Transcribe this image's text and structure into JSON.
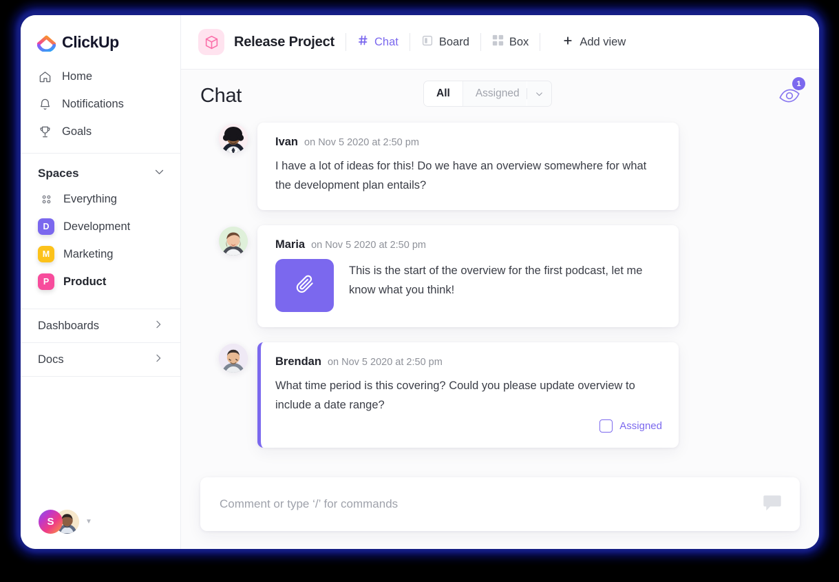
{
  "brand": {
    "name": "ClickUp",
    "accent": "#7b68ee",
    "frame_color": "#111a7e"
  },
  "sidebar": {
    "nav": [
      {
        "label": "Home",
        "icon": "home-icon"
      },
      {
        "label": "Notifications",
        "icon": "bell-icon"
      },
      {
        "label": "Goals",
        "icon": "trophy-icon"
      }
    ],
    "spaces_header": "Spaces",
    "spaces": [
      {
        "label": "Everything",
        "badge": "",
        "color": "",
        "icon": "grid-dots-icon",
        "active": false
      },
      {
        "label": "Development",
        "badge": "D",
        "color": "#7b68ee",
        "active": false
      },
      {
        "label": "Marketing",
        "badge": "M",
        "color": "#fcc21b",
        "active": false
      },
      {
        "label": "Product",
        "badge": "P",
        "color": "#f74c9c",
        "active": true
      }
    ],
    "sections": [
      {
        "label": "Dashboards",
        "icon": "chevron-right-icon"
      },
      {
        "label": "Docs",
        "icon": "chevron-right-icon"
      }
    ],
    "footer": {
      "user_initial": "S",
      "avatar_count": 2
    }
  },
  "topbar": {
    "project_title": "Release Project",
    "project_icon": "box-3d-icon",
    "views": [
      {
        "label": "Chat",
        "icon": "hash-icon",
        "active": true
      },
      {
        "label": "Board",
        "icon": "board-icon",
        "active": false
      },
      {
        "label": "Box",
        "icon": "box-grid-icon",
        "active": false
      }
    ],
    "add_view": {
      "label": "Add view",
      "icon": "plus-icon"
    }
  },
  "page": {
    "title": "Chat",
    "filter": {
      "selected": "All",
      "other": "Assigned",
      "caret_icon": "chevron-down-icon"
    },
    "watchers": {
      "icon": "eye-icon",
      "count": "1"
    }
  },
  "messages": [
    {
      "author": "Ivan",
      "time": "on Nov 5 2020 at 2:50 pm",
      "text": "I have a lot of ideas for this! Do we have an overview somewhere for what the development plan entails?",
      "flagged": false,
      "attachment": false,
      "assigned_label": null,
      "avatar_bg": "#fbeef2"
    },
    {
      "author": "Maria",
      "time": "on Nov 5 2020 at 2:50 pm",
      "text": "This is the start of the overview for the first podcast, let me know what you think!",
      "flagged": false,
      "attachment": true,
      "attachment_icon": "paperclip-icon",
      "assigned_label": null,
      "avatar_bg": "#e4f3e0"
    },
    {
      "author": "Brendan",
      "time": "on Nov 5 2020 at 2:50 pm",
      "text": "What time period is this covering? Could you please update overview to include a date range?",
      "flagged": true,
      "attachment": false,
      "assigned_label": "Assigned",
      "avatar_bg": "#efe8f6"
    }
  ],
  "composer": {
    "placeholder": "Comment or type ‘/’ for commands",
    "value": "",
    "icon": "comment-bubble-icon"
  }
}
